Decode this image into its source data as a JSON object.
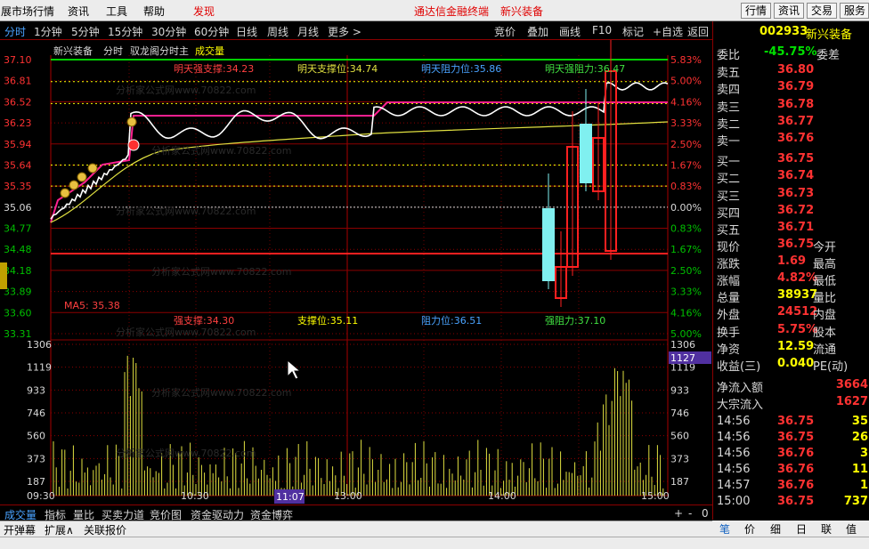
{
  "menu": {
    "items": [
      "展市场行情",
      "资讯",
      "工具",
      "帮助"
    ],
    "discover": "发现",
    "center_title": "通达信金融终端",
    "stock_name": "新兴装备",
    "right_buttons": [
      "行情",
      "资讯",
      "交易",
      "服务"
    ]
  },
  "period_tabs": {
    "items": [
      "分时",
      "1分钟",
      "5分钟",
      "15分钟",
      "30分钟",
      "60分钟",
      "日线",
      "周线",
      "月线",
      "更多 >"
    ],
    "tools": [
      "竞价",
      "叠加",
      "画线",
      "F10",
      "标记",
      "+自选",
      "返回"
    ]
  },
  "chart": {
    "header": [
      "新兴装备",
      "分时",
      "驭龙阁分时主",
      "成交量"
    ],
    "top_labels": {
      "qzc": "明天强支撑:34.23",
      "zc": "明天支撑位:34.74",
      "zl": "明天阻力位:35.86",
      "qzl": "明天强阻力:36.47"
    },
    "bottom_labels": {
      "qzc": "强支撑:34.30",
      "zc": "支撑位:35.11",
      "zl": "阻力位:36.51",
      "qzl": "强阻力:37.10"
    },
    "ma5": "MA5: 35.38",
    "price_ticks": [
      "37.10",
      "36.81",
      "36.52",
      "36.23",
      "35.94",
      "35.64",
      "35.35",
      "35.06",
      "34.77",
      "34.48",
      "34.18",
      "33.89",
      "33.60",
      "33.31"
    ],
    "pct_ticks": [
      "5.83%",
      "5.00%",
      "4.16%",
      "3.33%",
      "2.50%",
      "1.67%",
      "0.83%",
      "0.00%",
      "0.83%",
      "1.67%",
      "2.50%",
      "3.33%",
      "4.16%",
      "5.00%"
    ],
    "vol_ticks": [
      "1306",
      "1119",
      "933",
      "746",
      "560",
      "373",
      "187"
    ],
    "vol_cursor": "1127",
    "time_labels": [
      "09:30",
      "10:30",
      "13:00",
      "14:00",
      "15:00"
    ],
    "cursor_time": "11:07",
    "watermark": "分析家公式网www.70822.com"
  },
  "quote": {
    "code": "002933",
    "name": "新兴装备",
    "weibi_label": "委比",
    "weibi": "-45.75%",
    "weicha_label": "委差",
    "sells": [
      {
        "label": "卖五",
        "price": "36.80"
      },
      {
        "label": "卖四",
        "price": "36.79"
      },
      {
        "label": "卖三",
        "price": "36.78"
      },
      {
        "label": "卖二",
        "price": "36.77"
      },
      {
        "label": "卖一",
        "price": "36.76"
      }
    ],
    "buys": [
      {
        "label": "买一",
        "price": "36.75"
      },
      {
        "label": "买二",
        "price": "36.74"
      },
      {
        "label": "买三",
        "price": "36.73"
      },
      {
        "label": "买四",
        "price": "36.72"
      },
      {
        "label": "买五",
        "price": "36.71"
      }
    ],
    "stats": [
      {
        "k": "现价",
        "v": "36.75",
        "e": "今开"
      },
      {
        "k": "涨跌",
        "v": "1.69",
        "e": "最高"
      },
      {
        "k": "涨幅",
        "v": "4.82%",
        "e": "最低"
      },
      {
        "k": "总量",
        "v": "38937",
        "e": "量比",
        "yellow": true
      },
      {
        "k": "外盘",
        "v": "24512",
        "e": "内盘"
      }
    ],
    "stats2": [
      {
        "k": "换手",
        "v": "5.75%",
        "e": "股本"
      },
      {
        "k": "净资",
        "v": "12.59",
        "e": "流通"
      },
      {
        "k": "收益(三)",
        "v": "0.040",
        "e": "PE(动)"
      }
    ],
    "flow": [
      {
        "k": "净流入额",
        "v": "3664"
      },
      {
        "k": "大宗流入",
        "v": "1627"
      }
    ],
    "ticks": [
      {
        "t": "14:56",
        "p": "36.75",
        "v": "35"
      },
      {
        "t": "14:56",
        "p": "36.75",
        "v": "26"
      },
      {
        "t": "14:56",
        "p": "36.76",
        "v": "3"
      },
      {
        "t": "14:56",
        "p": "36.76",
        "v": "11"
      },
      {
        "t": "14:57",
        "p": "36.76",
        "v": "1"
      },
      {
        "t": "15:00",
        "p": "36.75",
        "v": "737"
      }
    ]
  },
  "bottom_tabs": [
    "成交量",
    "指标",
    "量比",
    "买卖力道",
    "竞价图",
    "资金驱动力",
    "资金博弈"
  ],
  "bottom_right": [
    "+",
    "-",
    "0"
  ],
  "status": [
    "开弹幕",
    "扩展∧",
    "关联报价"
  ],
  "right_tabs": [
    "笔",
    "价",
    "细",
    "日",
    "联",
    "值"
  ],
  "colors": {
    "up": "#ff3232",
    "down": "#00c8c8",
    "accent": "#4aa3ff",
    "yellow": "#ffff00"
  }
}
